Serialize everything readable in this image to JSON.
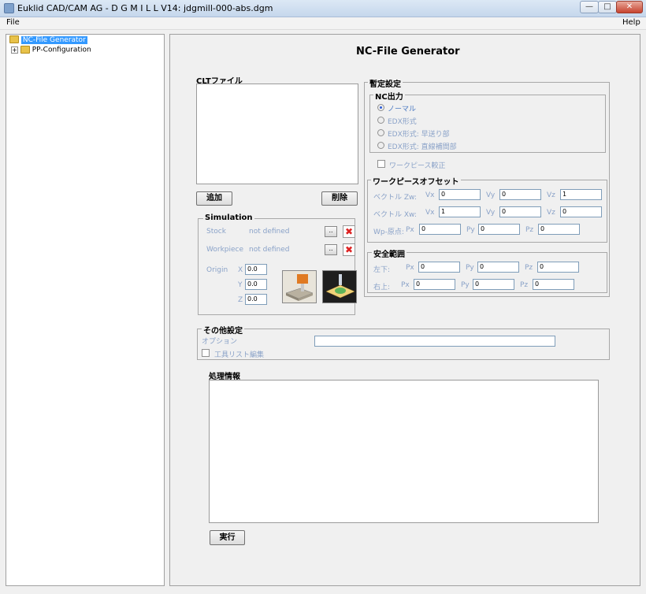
{
  "window": {
    "title": "Euklid CAD/CAM AG  -  D G M I L L  V14:  jdgmill-000-abs.dgm",
    "min": "—",
    "max": "□",
    "close": "✕"
  },
  "menu": {
    "file": "File",
    "help": "Help"
  },
  "tree": {
    "items": [
      {
        "label": "NC-File Generator"
      },
      {
        "label": "PP-Configuration"
      }
    ]
  },
  "main": {
    "title": "NC-File Generator",
    "clt": {
      "label": "CLTファイル",
      "add": "追加",
      "delete": "削除"
    },
    "simulation": {
      "legend": "Simulation",
      "stock_label": "Stock",
      "stock_value": "not defined",
      "workpiece_label": "Workpiece",
      "workpiece_value": "not defined",
      "browse": "..",
      "origin_label": "Origin",
      "x_label": "X",
      "x": "0.0",
      "y_label": "Y",
      "y": "0.0",
      "z_label": "Z",
      "z": "0.0"
    },
    "provisional": {
      "legend": "暫定設定",
      "nc_output": {
        "legend": "NC出力",
        "options": [
          "ノーマル",
          "EDX形式",
          "EDX形式: 早送り部",
          "EDX形式: 直線補間部"
        ],
        "selected": 0
      },
      "workpiece_correction": "ワークピース較正",
      "offset": {
        "legend": "ワークピースオフセット",
        "rows": [
          {
            "label": "ベクトル Zw:",
            "l1": "Vx",
            "v1": "0",
            "l2": "Vy",
            "v2": "0",
            "l3": "Vz",
            "v3": "1"
          },
          {
            "label": "ベクトル Xw:",
            "l1": "Vx",
            "v1": "1",
            "l2": "Vy",
            "v2": "0",
            "l3": "Vz",
            "v3": "0"
          },
          {
            "label": "Wp-原点:",
            "l1": "Px",
            "v1": "0",
            "l2": "Py",
            "v2": "0",
            "l3": "Pz",
            "v3": "0"
          }
        ]
      },
      "safety": {
        "legend": "安全範囲",
        "rows": [
          {
            "label": "左下:",
            "l1": "Px",
            "v1": "0",
            "l2": "Py",
            "v2": "0",
            "l3": "Pz",
            "v3": "0"
          },
          {
            "label": "右上:",
            "l1": "Px",
            "v1": "0",
            "l2": "Py",
            "v2": "0",
            "l3": "Pz",
            "v3": "0"
          }
        ]
      }
    },
    "other": {
      "legend": "その他設定",
      "option_label": "オプション",
      "option_value": "",
      "tool_list": "工具リスト編集"
    },
    "process_info": {
      "label": "処理情報",
      "text": ""
    },
    "run": "実行"
  }
}
